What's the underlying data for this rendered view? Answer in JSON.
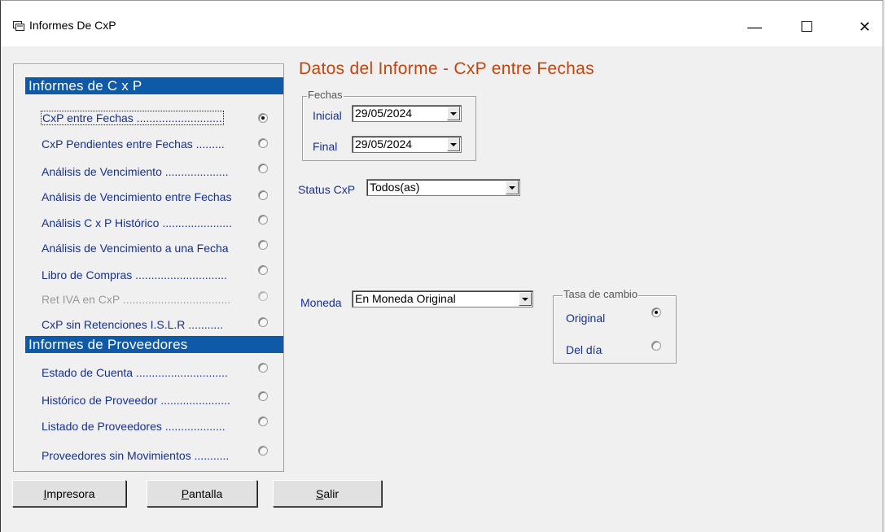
{
  "window": {
    "title": "Informes De CxP",
    "app_icon": "report-icon"
  },
  "controls": {
    "minimize": "—",
    "maximize": "☐",
    "close": "✕"
  },
  "cxp_section": {
    "title": "Informes de C x P",
    "options": [
      {
        "label": "CxP entre Fechas ...........................",
        "selected": true,
        "enabled": true
      },
      {
        "label": "CxP Pendientes entre Fechas .........",
        "selected": false,
        "enabled": true
      },
      {
        "label": "Análisis de Vencimiento ....................",
        "selected": false,
        "enabled": true
      },
      {
        "label": "Análisis de Vencimiento entre Fechas",
        "selected": false,
        "enabled": true
      },
      {
        "label": "Análisis C x P Histórico ......................",
        "selected": false,
        "enabled": true
      },
      {
        "label": "Análisis de Vencimiento a una Fecha",
        "selected": false,
        "enabled": true
      },
      {
        "label": "Libro de Compras .............................",
        "selected": false,
        "enabled": true
      },
      {
        "label": "Ret IVA en CxP ..................................",
        "selected": false,
        "enabled": false
      },
      {
        "label": "CxP sin Retenciones I.S.L.R ...........",
        "selected": false,
        "enabled": true
      }
    ]
  },
  "proveedores_section": {
    "title": "Informes de Proveedores",
    "options": [
      {
        "label": "Estado de Cuenta .............................",
        "selected": false
      },
      {
        "label": "Histórico de Proveedor ......................",
        "selected": false
      },
      {
        "label": "Listado de Proveedores ...................",
        "selected": false
      },
      {
        "label": "Proveedores sin Movimientos ...........",
        "selected": false
      }
    ]
  },
  "report": {
    "heading": "Datos del Informe - CxP entre Fechas",
    "fechas": {
      "group_title": "Fechas",
      "inicial_label": "Inicial",
      "inicial_value": "29/05/2024",
      "final_label": "Final",
      "final_value": "29/05/2024"
    },
    "status": {
      "label": "Status CxP",
      "value": "Todos(as)"
    },
    "moneda": {
      "label": "Moneda",
      "value": "En Moneda Original"
    },
    "tasa": {
      "group_title": "Tasa de cambio",
      "original_label": "Original",
      "original_selected": true,
      "deldia_label": "Del día",
      "deldia_selected": false
    }
  },
  "buttons": {
    "impresora": {
      "hotkey": "I",
      "rest": "mpresora"
    },
    "pantalla": {
      "hotkey": "P",
      "rest": "antalla"
    },
    "salir": {
      "hotkey": "S",
      "rest": "alir"
    }
  }
}
